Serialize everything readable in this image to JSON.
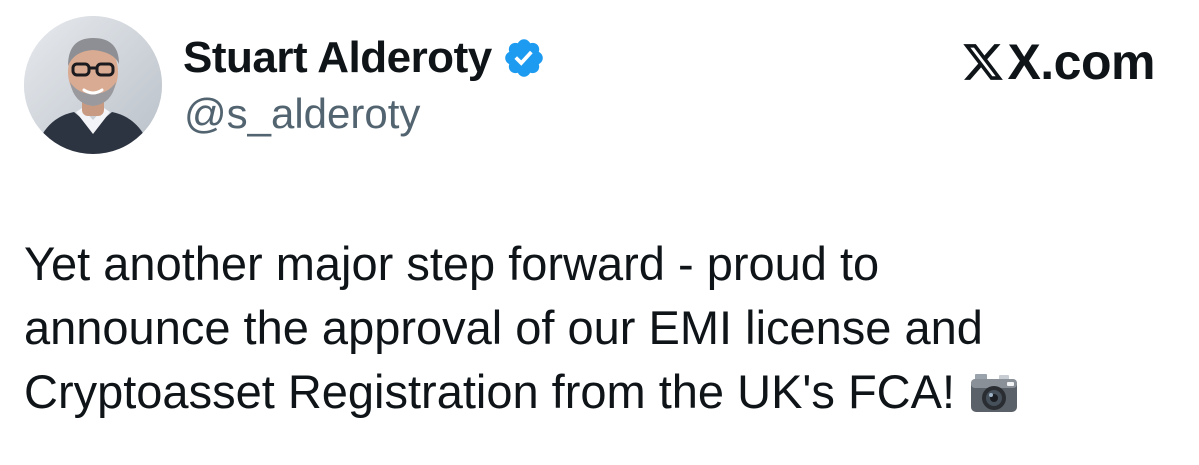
{
  "author": {
    "display_name": "Stuart Alderoty",
    "handle": "@s_alderoty",
    "verified": true,
    "avatar_icon": "profile-photo"
  },
  "brand": {
    "label": "X.com",
    "icon": "x-logo-icon"
  },
  "tweet": {
    "lines": [
      "Yet another major step forward - proud to",
      "announce the approval of our EMI license and",
      "Cryptoasset Registration from the UK's FCA!"
    ],
    "emoji": "camera-with-flash-icon"
  },
  "colors": {
    "text_primary": "#0f1419",
    "text_secondary": "#536471",
    "verified_blue": "#1d9bf0",
    "background": "#ffffff"
  }
}
